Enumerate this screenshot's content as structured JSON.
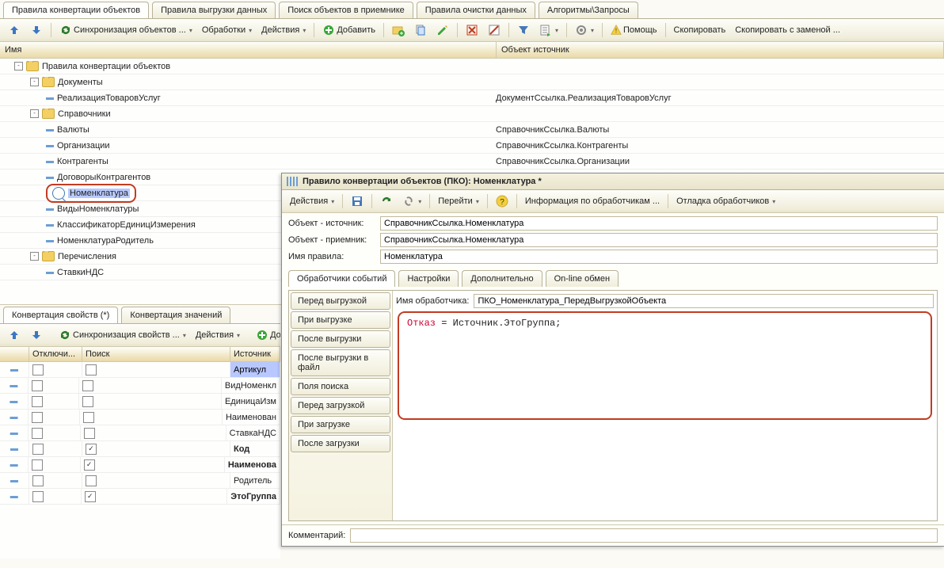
{
  "maintabs": [
    "Правила конвертации объектов",
    "Правила выгрузки данных",
    "Поиск объектов в приемнике",
    "Правила очистки данных",
    "Алгоритмы\\Запросы"
  ],
  "tb": {
    "sync": "Синхронизация объектов ...",
    "proc": "Обработки",
    "actions": "Действия",
    "add": "Добавить",
    "help": "Помощь",
    "copy": "Скопировать",
    "copyrep": "Скопировать с заменой ..."
  },
  "treecols": {
    "c1": "Имя",
    "c2": "Объект источник"
  },
  "tree": [
    {
      "lvl": 0,
      "exp": "-",
      "fold": true,
      "txt": "Правила конвертации объектов"
    },
    {
      "lvl": 1,
      "exp": "-",
      "fold": true,
      "txt": "Документы"
    },
    {
      "lvl": 2,
      "bul": true,
      "txt": "РеализацияТоваровУслуг",
      "src": "ДокументСсылка.РеализацияТоваровУслуг"
    },
    {
      "lvl": 1,
      "exp": "-",
      "fold": true,
      "txt": "Справочники"
    },
    {
      "lvl": 2,
      "bul": true,
      "txt": "Валюты",
      "src": "СправочникСсылка.Валюты"
    },
    {
      "lvl": 2,
      "bul": true,
      "txt": "Организации",
      "src": "СправочникСсылка.Контрагенты"
    },
    {
      "lvl": 2,
      "bul": true,
      "txt": "Контрагенты",
      "src": "СправочникСсылка.Организации"
    },
    {
      "lvl": 2,
      "bul": true,
      "txt": "ДоговорыКонтрагентов"
    },
    {
      "lvl": 2,
      "selected": true,
      "txt": "Номенклатура"
    },
    {
      "lvl": 2,
      "bul": true,
      "txt": "ВидыНоменклатуры"
    },
    {
      "lvl": 2,
      "bul": true,
      "txt": "КлассификаторЕдиницИзмерения"
    },
    {
      "lvl": 2,
      "bul": true,
      "txt": "НоменклатураРодитель"
    },
    {
      "lvl": 1,
      "exp": "-",
      "fold": true,
      "txt": "Перечисления"
    },
    {
      "lvl": 2,
      "bul": true,
      "txt": "СтавкиНДС"
    }
  ],
  "lowtabs": [
    "Конвертация свойств (*)",
    "Конвертация значений"
  ],
  "lowtb": {
    "sync": "Синхронизация свойств ...",
    "actions": "Действия",
    "add": "Добавить"
  },
  "gridh": {
    "off": "Отключи...",
    "search": "Поиск",
    "src": "Источник"
  },
  "grid": [
    {
      "off": false,
      "search": false,
      "src": "Артикул",
      "sel": true
    },
    {
      "off": false,
      "search": false,
      "src": "ВидНоменкл"
    },
    {
      "off": false,
      "search": false,
      "src": "ЕдиницаИзм"
    },
    {
      "off": false,
      "search": false,
      "src": "Наименован"
    },
    {
      "off": false,
      "search": false,
      "src": "СтавкаНДС"
    },
    {
      "off": false,
      "search": true,
      "src": "Код",
      "bold": true
    },
    {
      "off": false,
      "search": true,
      "src": "Наименова",
      "bold": true
    },
    {
      "off": false,
      "search": false,
      "src": "Родитель"
    },
    {
      "off": false,
      "search": true,
      "src": "ЭтоГруппа",
      "bold": true
    }
  ],
  "dlg": {
    "title": "Правило конвертации объектов (ПКО): Номенклатура *",
    "tb": {
      "actions": "Действия",
      "goto": "Перейти",
      "info": "Информация по обработчикам ...",
      "debug": "Отладка обработчиков"
    },
    "form": {
      "l1": "Объект - источник:",
      "v1": "СправочникСсылка.Номенклатура",
      "l2": "Объект - приемник:",
      "v2": "СправочникСсылка.Номенклатура",
      "l3": "Имя правила:",
      "v3": "Номенклатура"
    },
    "tabs": [
      "Обработчики событий",
      "Настройки",
      "Дополнительно",
      "On-line обмен"
    ],
    "hooks": [
      "Перед выгрузкой",
      "При выгрузке",
      "После выгрузки",
      "После выгрузки в файл",
      "Поля поиска",
      "Перед загрузкой",
      "При загрузке",
      "После загрузки"
    ],
    "hnameL": "Имя обработчика:",
    "hnameV": "ПКО_Номенклатура_ПередВыгрузкойОбъекта",
    "code": {
      "a": "Отказ",
      "b": " = Источник.ЭтоГруппа;"
    },
    "commentL": "Комментарий:"
  }
}
